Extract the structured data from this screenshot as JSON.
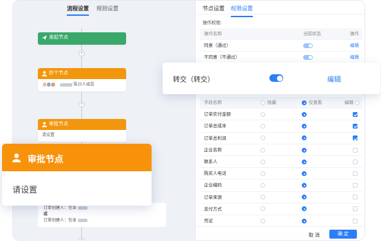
{
  "canvas": {
    "tabs": [
      "流程设置",
      "规则设置"
    ],
    "start_node": {
      "title": "发起节点"
    },
    "cc_node": {
      "title": "抄个节点",
      "body_suffix": "等20人或签"
    },
    "approval_node": {
      "title": "审批节点",
      "body": "请设置"
    },
    "bottom_node": {
      "line1_prefix": "订单创建人：包含",
      "line2": "或",
      "line3_prefix": "订单创建人：包含"
    }
  },
  "panel": {
    "tabs": [
      "节点设置",
      "权限设置"
    ],
    "active_tab": "权限设置",
    "ops_label": "操作权限:",
    "ops_headers": [
      "操作名称",
      "当前状态",
      "操作"
    ],
    "ops_rows": [
      {
        "name": "同意（通过）",
        "state": true,
        "action": "编辑"
      },
      {
        "name": "不同意（不通过）",
        "state": true,
        "action": "编辑"
      }
    ],
    "field_headers": [
      "字段名称",
      "隐藏",
      "仅查看",
      "编辑"
    ],
    "fields": [
      {
        "name": "订单实付金额",
        "mode": "view",
        "edit": true
      },
      {
        "name": "订单总成本",
        "mode": "view",
        "edit": true
      },
      {
        "name": "订单总利润",
        "mode": "view",
        "edit": true
      },
      {
        "name": "企业名称",
        "mode": "view",
        "edit": false
      },
      {
        "name": "联系人",
        "mode": "view",
        "edit": false
      },
      {
        "name": "购买人电话",
        "mode": "view",
        "edit": false
      },
      {
        "name": "企业编码",
        "mode": "view",
        "edit": false
      },
      {
        "name": "订单来源",
        "mode": "view",
        "edit": false
      },
      {
        "name": "支付方式",
        "mode": "view",
        "edit": false
      },
      {
        "name": "凭证",
        "mode": "view",
        "edit": false
      }
    ],
    "cancel_label": "取 消",
    "ok_label": "确 定"
  },
  "float_transfer": {
    "name": "转交（转交）",
    "enabled": true,
    "action": "编辑"
  },
  "float_approval": {
    "title": "审批节点",
    "body": "请设置"
  },
  "colors": {
    "accent": "#2c7ef8",
    "orange": "#f7920a",
    "green": "#3aa86b"
  }
}
